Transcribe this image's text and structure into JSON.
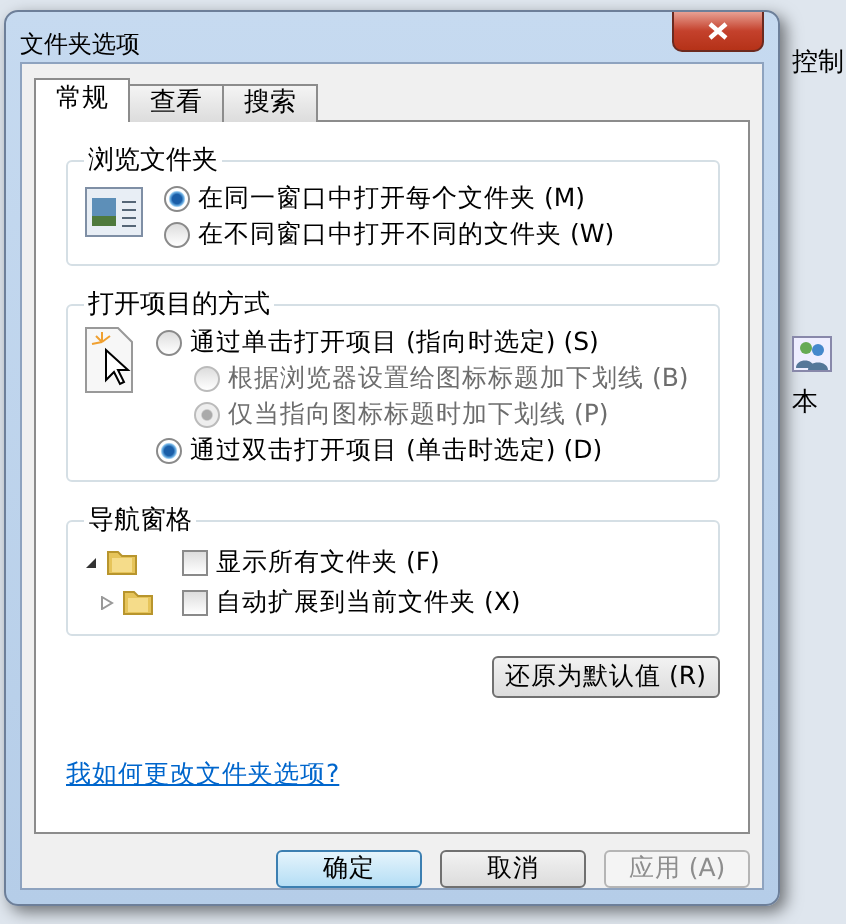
{
  "window": {
    "title": "文件夹选项"
  },
  "tabs": [
    {
      "label": "常规",
      "selected": true
    },
    {
      "label": "查看",
      "selected": false
    },
    {
      "label": "搜索",
      "selected": false
    }
  ],
  "browse_folders": {
    "title": "浏览文件夹",
    "options": [
      {
        "label": "在同一窗口中打开每个文件夹 (M)",
        "selected": true
      },
      {
        "label": "在不同窗口中打开不同的文件夹 (W)",
        "selected": false
      }
    ]
  },
  "open_items": {
    "title": "打开项目的方式",
    "options": [
      {
        "label": "通过单击打开项目 (指向时选定) (S)",
        "selected": false,
        "disabled": false,
        "children": [
          {
            "label": "根据浏览器设置给图标标题加下划线 (B)",
            "selected": false,
            "disabled": true
          },
          {
            "label": "仅当指向图标标题时加下划线 (P)",
            "selected": true,
            "disabled": true
          }
        ]
      },
      {
        "label": "通过双击打开项目 (单击时选定) (D)",
        "selected": true,
        "disabled": false
      }
    ]
  },
  "navigation_pane": {
    "title": "导航窗格",
    "items": [
      {
        "label": "显示所有文件夹 (F)",
        "checked": false,
        "expanded": true
      },
      {
        "label": "自动扩展到当前文件夹 (X)",
        "checked": false,
        "expanded": false
      }
    ]
  },
  "restore_button": "还原为默认值 (R)",
  "help_link": "我如何更改文件夹选项?",
  "buttons": [
    {
      "label": "确定",
      "kind": "default"
    },
    {
      "label": "取消",
      "kind": "normal"
    },
    {
      "label": "应用 (A)",
      "kind": "disabled"
    }
  ],
  "background": {
    "texts": [
      "控制",
      "本"
    ]
  }
}
